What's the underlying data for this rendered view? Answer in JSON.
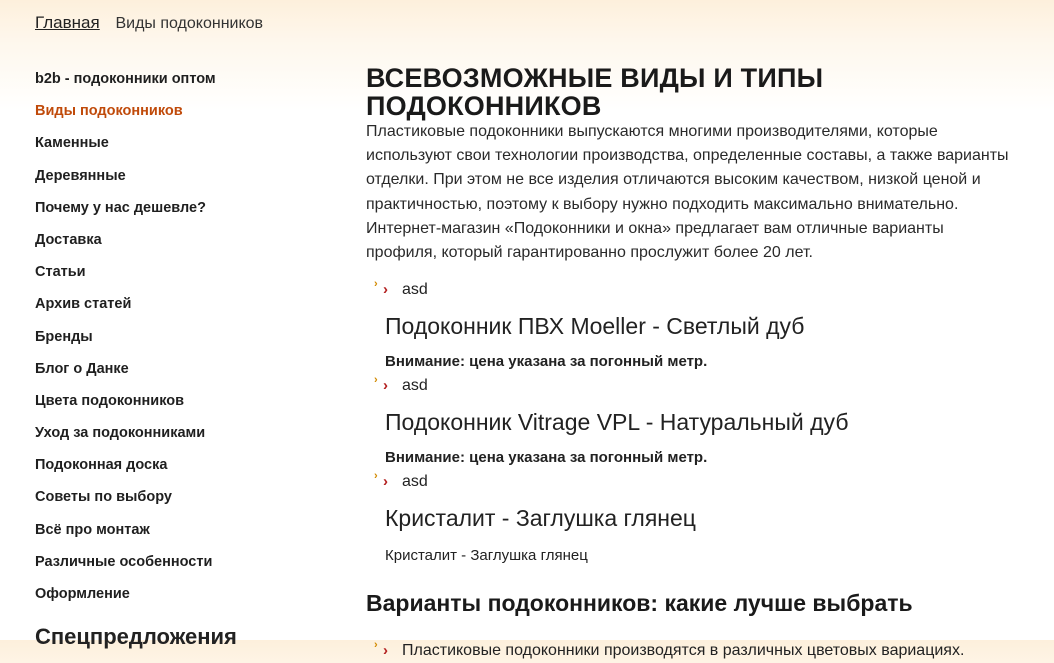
{
  "breadcrumb": {
    "home": "Главная",
    "current": "Виды подоконников"
  },
  "sidebar": {
    "items": [
      {
        "label": "b2b - подоконники оптом",
        "active": false
      },
      {
        "label": "Виды подоконников",
        "active": true
      },
      {
        "label": "Каменные",
        "active": false
      },
      {
        "label": "Деревянные",
        "active": false
      },
      {
        "label": "Почему у нас дешевле?",
        "active": false
      },
      {
        "label": "Доставка",
        "active": false
      },
      {
        "label": "Статьи",
        "active": false
      },
      {
        "label": "Архив статей",
        "active": false
      },
      {
        "label": "Бренды",
        "active": false
      },
      {
        "label": "Блог о Данке",
        "active": false
      },
      {
        "label": "Цвета подоконников",
        "active": false
      },
      {
        "label": "Уход за подоконниками",
        "active": false
      },
      {
        "label": "Подоконная доска",
        "active": false
      },
      {
        "label": "Советы по выбору",
        "active": false
      },
      {
        "label": "Всё про монтаж",
        "active": false
      },
      {
        "label": "Различные особенности",
        "active": false
      },
      {
        "label": "Оформление",
        "active": false
      }
    ],
    "subheading": "Спецпредложения"
  },
  "main": {
    "title": "Всевозможные виды и типы подоконников",
    "intro": "Пластиковые подоконники выпускаются многими производителями, которые используют свои технологии производства, определенные составы, а также варианты отделки. При этом не все изделия отличаются высоким качеством, низкой ценой и практичностью, поэтому к выбору нужно подходить максимально внимательно. Интернет-магазин «Подоконники и окна» предлагает вам отличные варианты профиля, который гарантированно прослужит более 20 лет.",
    "products": [
      {
        "bullet": "asd",
        "title": "Подоконник ПВХ Moeller - Светлый дуб",
        "note": "Внимание: цена указана за погонный метр."
      },
      {
        "bullet": "asd",
        "title": "Подоконник Vitrage VPL - Натуральный дуб",
        "note": "Внимание: цена указана за погонный метр."
      },
      {
        "bullet": "asd",
        "title": "Кристалит - Заглушка глянец",
        "plain": "Кристалит - Заглушка глянец"
      }
    ],
    "section_title": "Варианты подоконников: какие лучше выбрать",
    "section_bullet": "Пластиковые подоконники производятся в различных цветовых вариациях."
  }
}
